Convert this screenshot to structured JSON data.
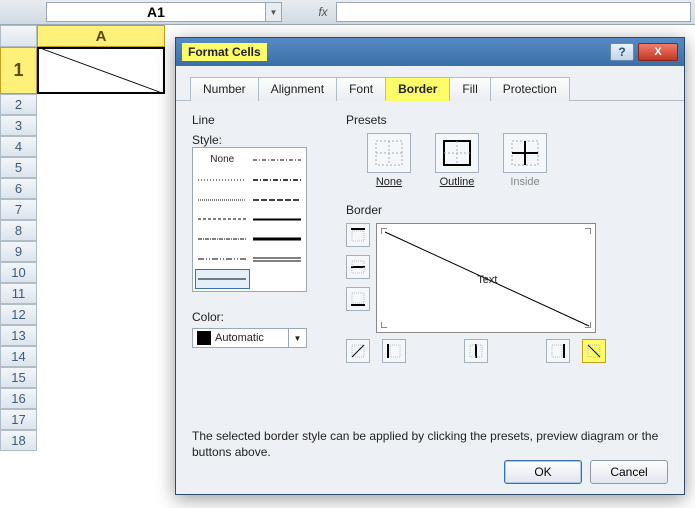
{
  "namebox": {
    "value": "A1"
  },
  "formula_bar": {
    "fx": "fx",
    "value": ""
  },
  "columns": [
    "A"
  ],
  "rows": [
    "1",
    "2",
    "3",
    "4",
    "5",
    "6",
    "7",
    "8",
    "9",
    "10",
    "11",
    "12",
    "13",
    "14",
    "15",
    "16",
    "17",
    "18"
  ],
  "dialog": {
    "title": "Format Cells",
    "help": "?",
    "close": "X",
    "tabs": [
      "Number",
      "Alignment",
      "Font",
      "Border",
      "Fill",
      "Protection"
    ],
    "active_tab": "Border",
    "line": {
      "group": "Line",
      "style_label": "Style:",
      "none": "None",
      "color_label": "Color:",
      "color_value": "Automatic"
    },
    "presets": {
      "group": "Presets",
      "none": "None",
      "outline": "Outline",
      "inside": "Inside"
    },
    "border": {
      "group": "Border",
      "preview_text": "Text"
    },
    "description": "The selected border style can be applied by clicking the presets, preview diagram or the buttons above.",
    "ok": "OK",
    "cancel": "Cancel"
  }
}
